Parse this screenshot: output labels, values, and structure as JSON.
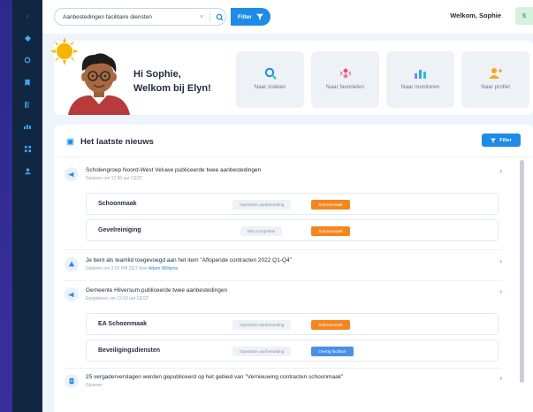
{
  "search": {
    "value": "Aanbestedingen facilitaire diensten",
    "clear": "×",
    "filter_label": "Filter"
  },
  "user": {
    "welcome": "Welkom, Sophie",
    "initial": "S"
  },
  "hero": {
    "greeting_line1": "Hi Sophie,",
    "greeting_line2": "Welkom bij Elyn!",
    "tiles": [
      {
        "label": "Naar zoeken",
        "icon": "search-icon"
      },
      {
        "label": "Naar favorieten",
        "icon": "favorites-icon"
      },
      {
        "label": "Naar monitoren",
        "icon": "bar-chart-icon"
      },
      {
        "label": "Naar profiel",
        "icon": "profile-icon"
      }
    ]
  },
  "news": {
    "title": "Het laatste nieuws",
    "filter_label": "Filter",
    "items": [
      {
        "title": "Scholengroep Noord-West Veluwe publiceerde twee aanbestedingen",
        "sub": "Gisteren om 17:00 uur CEST",
        "tenders": [
          {
            "name": "Schoonmaak",
            "procedure": "Openbare aanbesteding",
            "category": "Schoonmaak"
          },
          {
            "name": "Gevelreiniging",
            "procedure": "Mini competitie",
            "category": "Schoonmaak"
          }
        ]
      },
      {
        "title": "Je bent als teamlid toegevoegd aan het item \"Aflopende contracten 2022 Q1-Q4\"",
        "sub": "Gisteren om 2:02 PM CET door",
        "sub_link": "Adam Williams"
      },
      {
        "title": "Gemeente Hilversum publiceerde twee aanbestedingen",
        "sub": "Eergisteren om 15:03 uur CEST",
        "tenders": [
          {
            "name": "EA Schoonmaak",
            "procedure": "Openbare aanbesteding",
            "category": "Schoonmaak"
          },
          {
            "name": "Beveiligingsdiensten",
            "procedure": "Openbare aanbesteding",
            "category": "Overig facilitair"
          }
        ]
      },
      {
        "title": "25 vergaderverslagen werden gepubliceerd op het gebied van \"Vernieuwing contracten schoonmaak\"",
        "sub": "Gisteren"
      }
    ]
  },
  "colors": {
    "primary": "#1e8be6",
    "orange_tag": "#f5861f",
    "blue_tag": "#4a8fe8",
    "sidebar": "#112641"
  }
}
